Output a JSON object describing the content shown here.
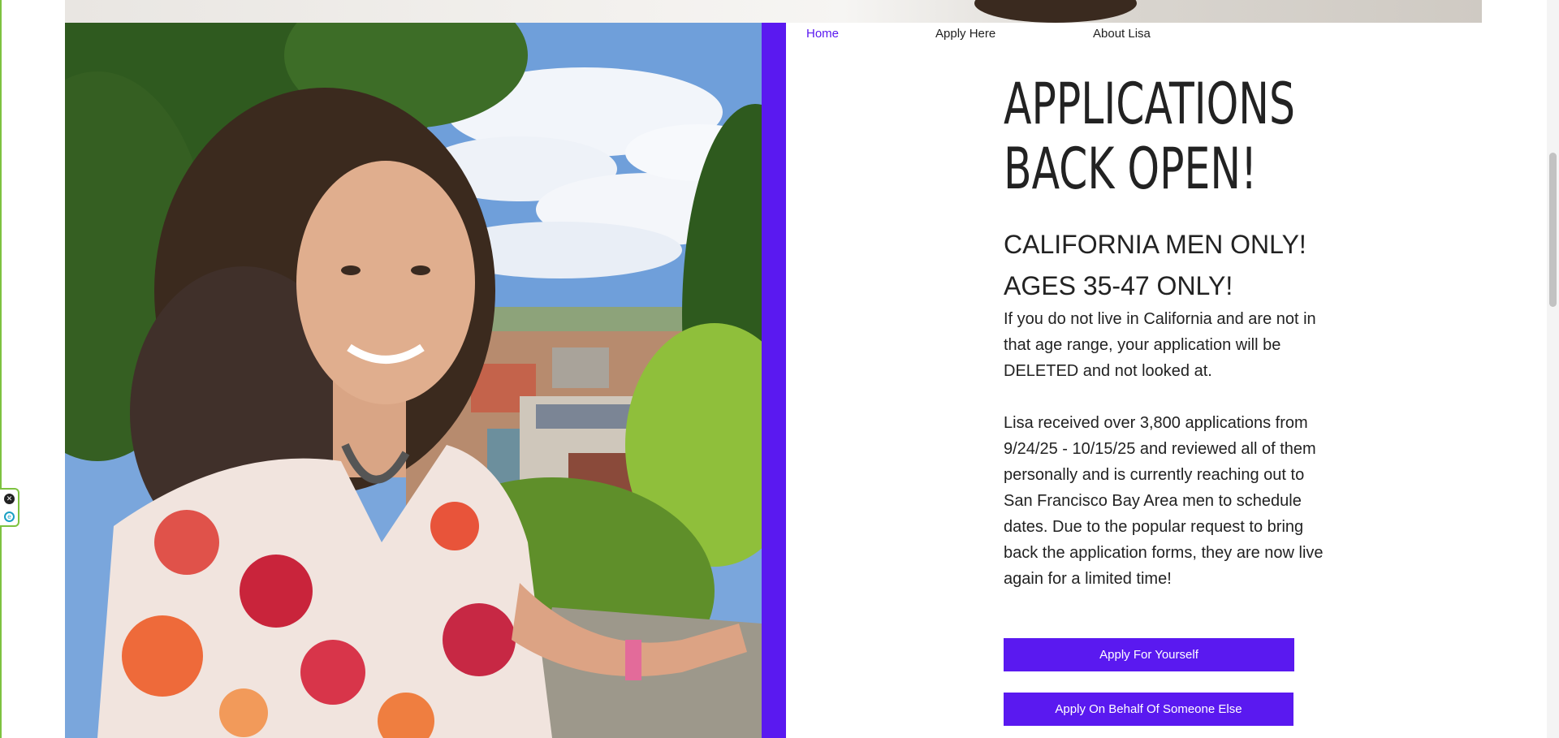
{
  "nav": {
    "items": [
      {
        "label": "Home",
        "active": true
      },
      {
        "label": "Apply Here",
        "active": false
      },
      {
        "label": "About Lisa",
        "active": false
      }
    ]
  },
  "hero": {
    "headline_line1": "APPLICATIONS",
    "headline_line2": "BACK OPEN!",
    "sub_line1": "CALIFORNIA MEN ONLY!",
    "sub_line2": "AGES 35-47 ONLY!",
    "paragraph1": "If you do not live in California and are not in that age range, your application will be DELETED and not looked at.",
    "paragraph2": "Lisa received over 3,800 applications from 9/24/25 - 10/15/25 and reviewed all of them personally and is currently reaching out to San Francisco Bay Area men to schedule dates. Due to the popular request to bring back the application forms, they are now live again for a limited time!"
  },
  "buttons": {
    "apply_self": "Apply For Yourself",
    "apply_other": "Apply On Behalf Of Someone Else"
  },
  "colors": {
    "accent": "#5a19f0",
    "text": "#222222",
    "widget_border": "#7dc23f"
  },
  "icons": {
    "widget_close": "close-icon",
    "widget_logo": "extension-logo-icon"
  }
}
